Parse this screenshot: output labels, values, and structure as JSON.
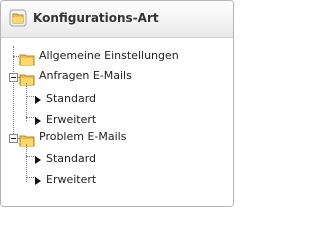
{
  "header": {
    "title": "Konfigurations-Art",
    "icon": "folder-icon"
  },
  "tree": {
    "items": [
      {
        "label": "Allgemeine Einstellungen",
        "icon": "folder-icon"
      },
      {
        "label": "Anfragen E-Mails",
        "icon": "folder-icon",
        "expanded": true,
        "children": [
          {
            "label": "Standard",
            "icon": "arrow-right-icon"
          },
          {
            "label": "Erweitert",
            "icon": "arrow-right-icon"
          }
        ]
      },
      {
        "label": "Problem E-Mails",
        "icon": "folder-icon",
        "expanded": true,
        "children": [
          {
            "label": "Standard",
            "icon": "arrow-right-icon"
          },
          {
            "label": "Erweitert",
            "icon": "arrow-right-icon"
          }
        ]
      }
    ]
  }
}
